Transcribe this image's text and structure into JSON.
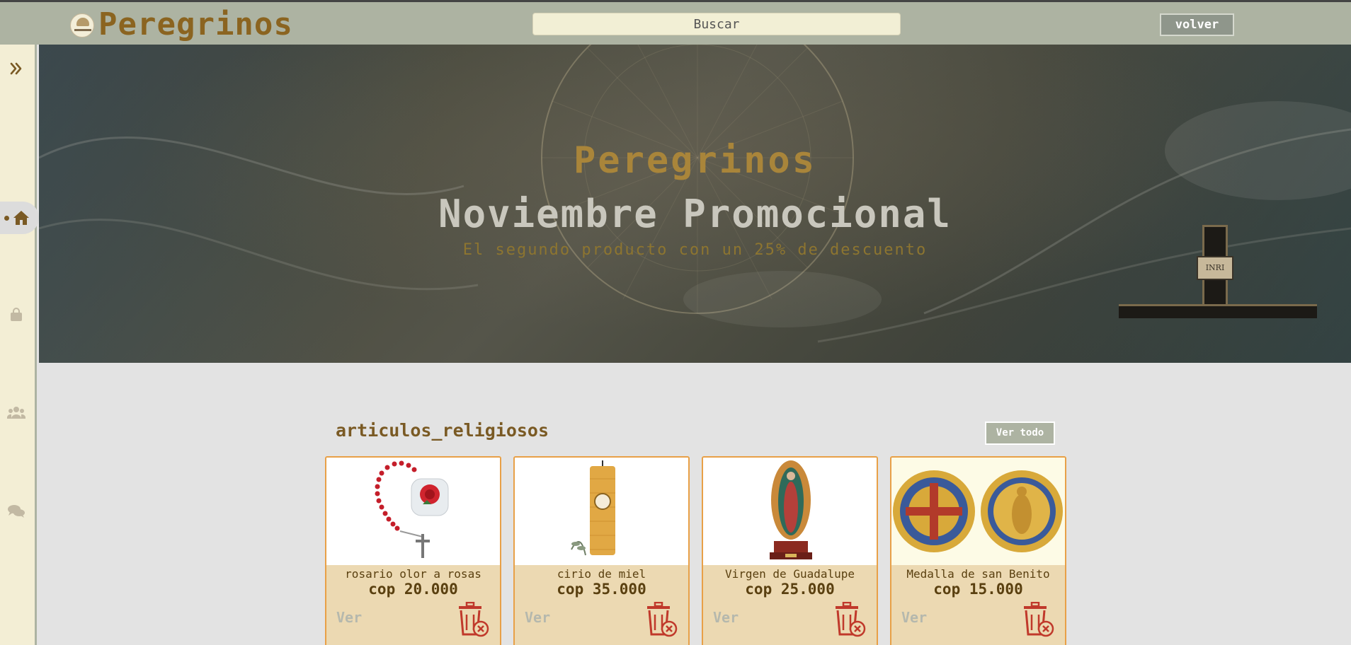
{
  "header": {
    "brand": "Peregrinos",
    "search_placeholder": "Buscar",
    "back_label": "volver"
  },
  "sidebar": {
    "items": [
      {
        "icon": "double-chevron-right-icon"
      },
      {
        "icon": "home-icon",
        "active": true
      },
      {
        "icon": "shopping-bag-icon"
      },
      {
        "icon": "users-icon"
      },
      {
        "icon": "chat-icon"
      }
    ]
  },
  "hero": {
    "title": "Peregrinos",
    "subtitle": "Noviembre Promocional",
    "description": "El segundo producto con un 25% de descuento",
    "plaque_text": "INRI"
  },
  "section": {
    "title": "articulos_religiosos",
    "see_all_label": "Ver todo"
  },
  "products": [
    {
      "name": "rosario olor a rosas",
      "price": "cop 20.000",
      "view_label": "Ver",
      "image": "rosary-image"
    },
    {
      "name": "cirio de miel",
      "price": "cop 35.000",
      "view_label": "Ver",
      "image": "candle-image"
    },
    {
      "name": "Virgen de Guadalupe",
      "price": "cop 25.000",
      "view_label": "Ver",
      "image": "statue-image"
    },
    {
      "name": "Medalla de san Benito",
      "price": "cop 15.000",
      "view_label": "Ver",
      "image": "medal-image"
    }
  ],
  "colors": {
    "header_bg": "#adb3a2",
    "sidebar_bg": "#f3eed5",
    "brand": "#8b6420",
    "card_border": "#e8a047",
    "card_bg": "#ecd9b2",
    "trash": "#c0392b"
  }
}
